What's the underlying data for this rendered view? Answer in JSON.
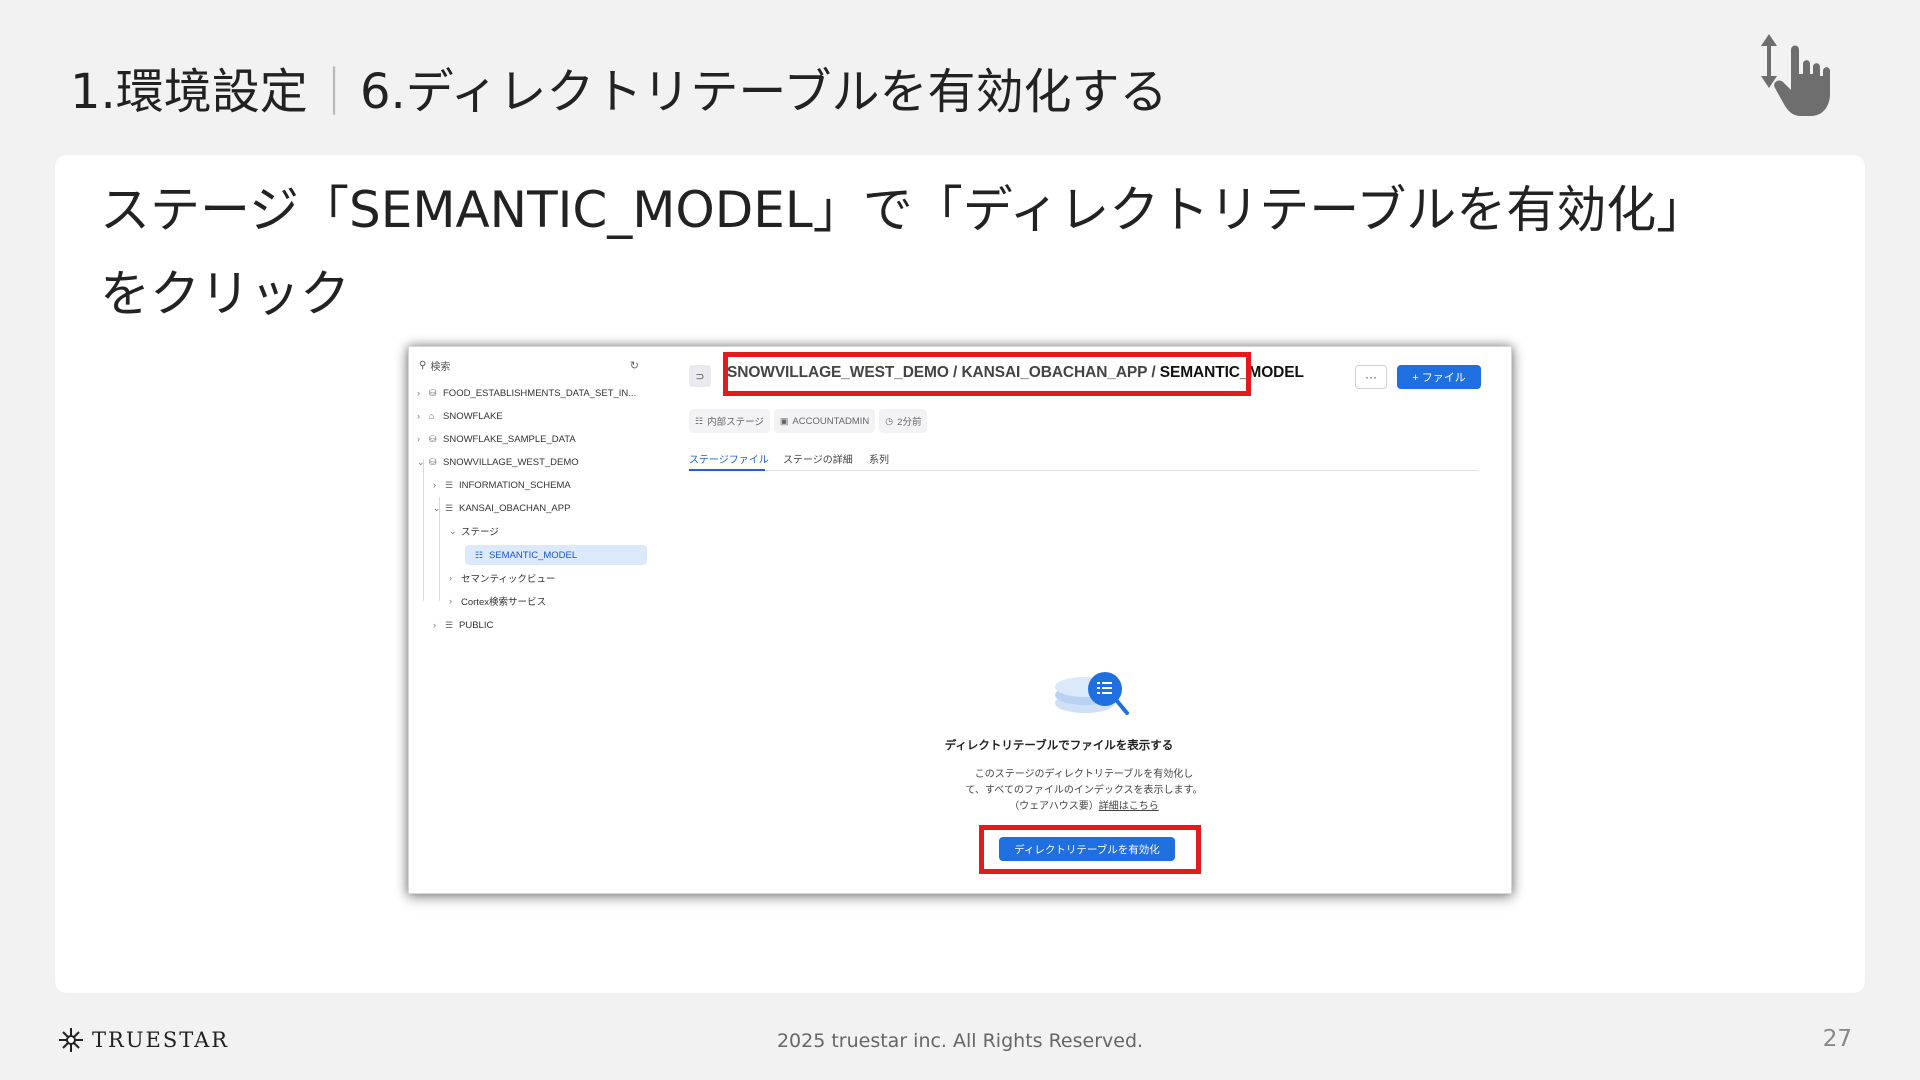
{
  "slide": {
    "section": "1.環境設定",
    "separator": "|",
    "step": "6.ディレクトリテーブルを有効化する",
    "instruction_line1": "ステージ「SEMANTIC_MODEL」で「ディレクトリテーブルを有効化」",
    "instruction_line2": "をクリック"
  },
  "screenshot": {
    "sidebar": {
      "search_placeholder": "検索",
      "refresh_icon": "refresh-icon",
      "items": [
        {
          "label": "FOOD_ESTABLISHMENTS_DATA_SET_IN...",
          "icon": "database-icon",
          "expanded": false
        },
        {
          "label": "SNOWFLAKE",
          "icon": "snowflake-icon",
          "expanded": false
        },
        {
          "label": "SNOWFLAKE_SAMPLE_DATA",
          "icon": "database-icon",
          "expanded": false
        },
        {
          "label": "SNOWVILLAGE_WEST_DEMO",
          "icon": "database-icon",
          "expanded": true
        },
        {
          "label": "INFORMATION_SCHEMA",
          "icon": "schema-icon",
          "expanded": false
        },
        {
          "label": "KANSAI_OBACHAN_APP",
          "icon": "schema-icon",
          "expanded": true
        },
        {
          "label": "ステージ",
          "icon": "",
          "expanded": true
        },
        {
          "label": "SEMANTIC_MODEL",
          "icon": "stage-icon",
          "selected": true
        },
        {
          "label": "セマンティックビュー",
          "icon": "",
          "expanded": false
        },
        {
          "label": "Cortex検索サービス",
          "icon": "",
          "expanded": false
        },
        {
          "label": "PUBLIC",
          "icon": "schema-icon",
          "expanded": false
        }
      ]
    },
    "breadcrumb": {
      "part1": "SNOWVILLAGE_WEST_DEMO",
      "part2": "KANSAI_OBACHAN_APP",
      "part3": "SEMANTIC_MODEL",
      "sep": " / "
    },
    "more_label": "···",
    "file_button": "+ ファイル",
    "meta": {
      "type": "内部ステージ",
      "owner": "ACCOUNTADMIN",
      "time": "2分前"
    },
    "tabs": [
      "ステージファイル",
      "ステージの詳細",
      "系列"
    ],
    "empty_state": {
      "title": "ディレクトリテーブルでファイルを表示する",
      "desc_line1": "このステージのディレクトリテーブルを有効化し",
      "desc_line2": "て、すべてのファイルのインデックスを表示します。",
      "desc_line3": "（ウェアハウス要）",
      "desc_link": "詳細はこちら",
      "button": "ディレクトリテーブルを有効化"
    },
    "highlight_color": "#e31b1b",
    "accent_color": "#1f6fe0"
  },
  "footer": {
    "logo": "TRUESTAR",
    "copyright": "2025 truestar inc. All Rights Reserved.",
    "page_number": "27"
  }
}
